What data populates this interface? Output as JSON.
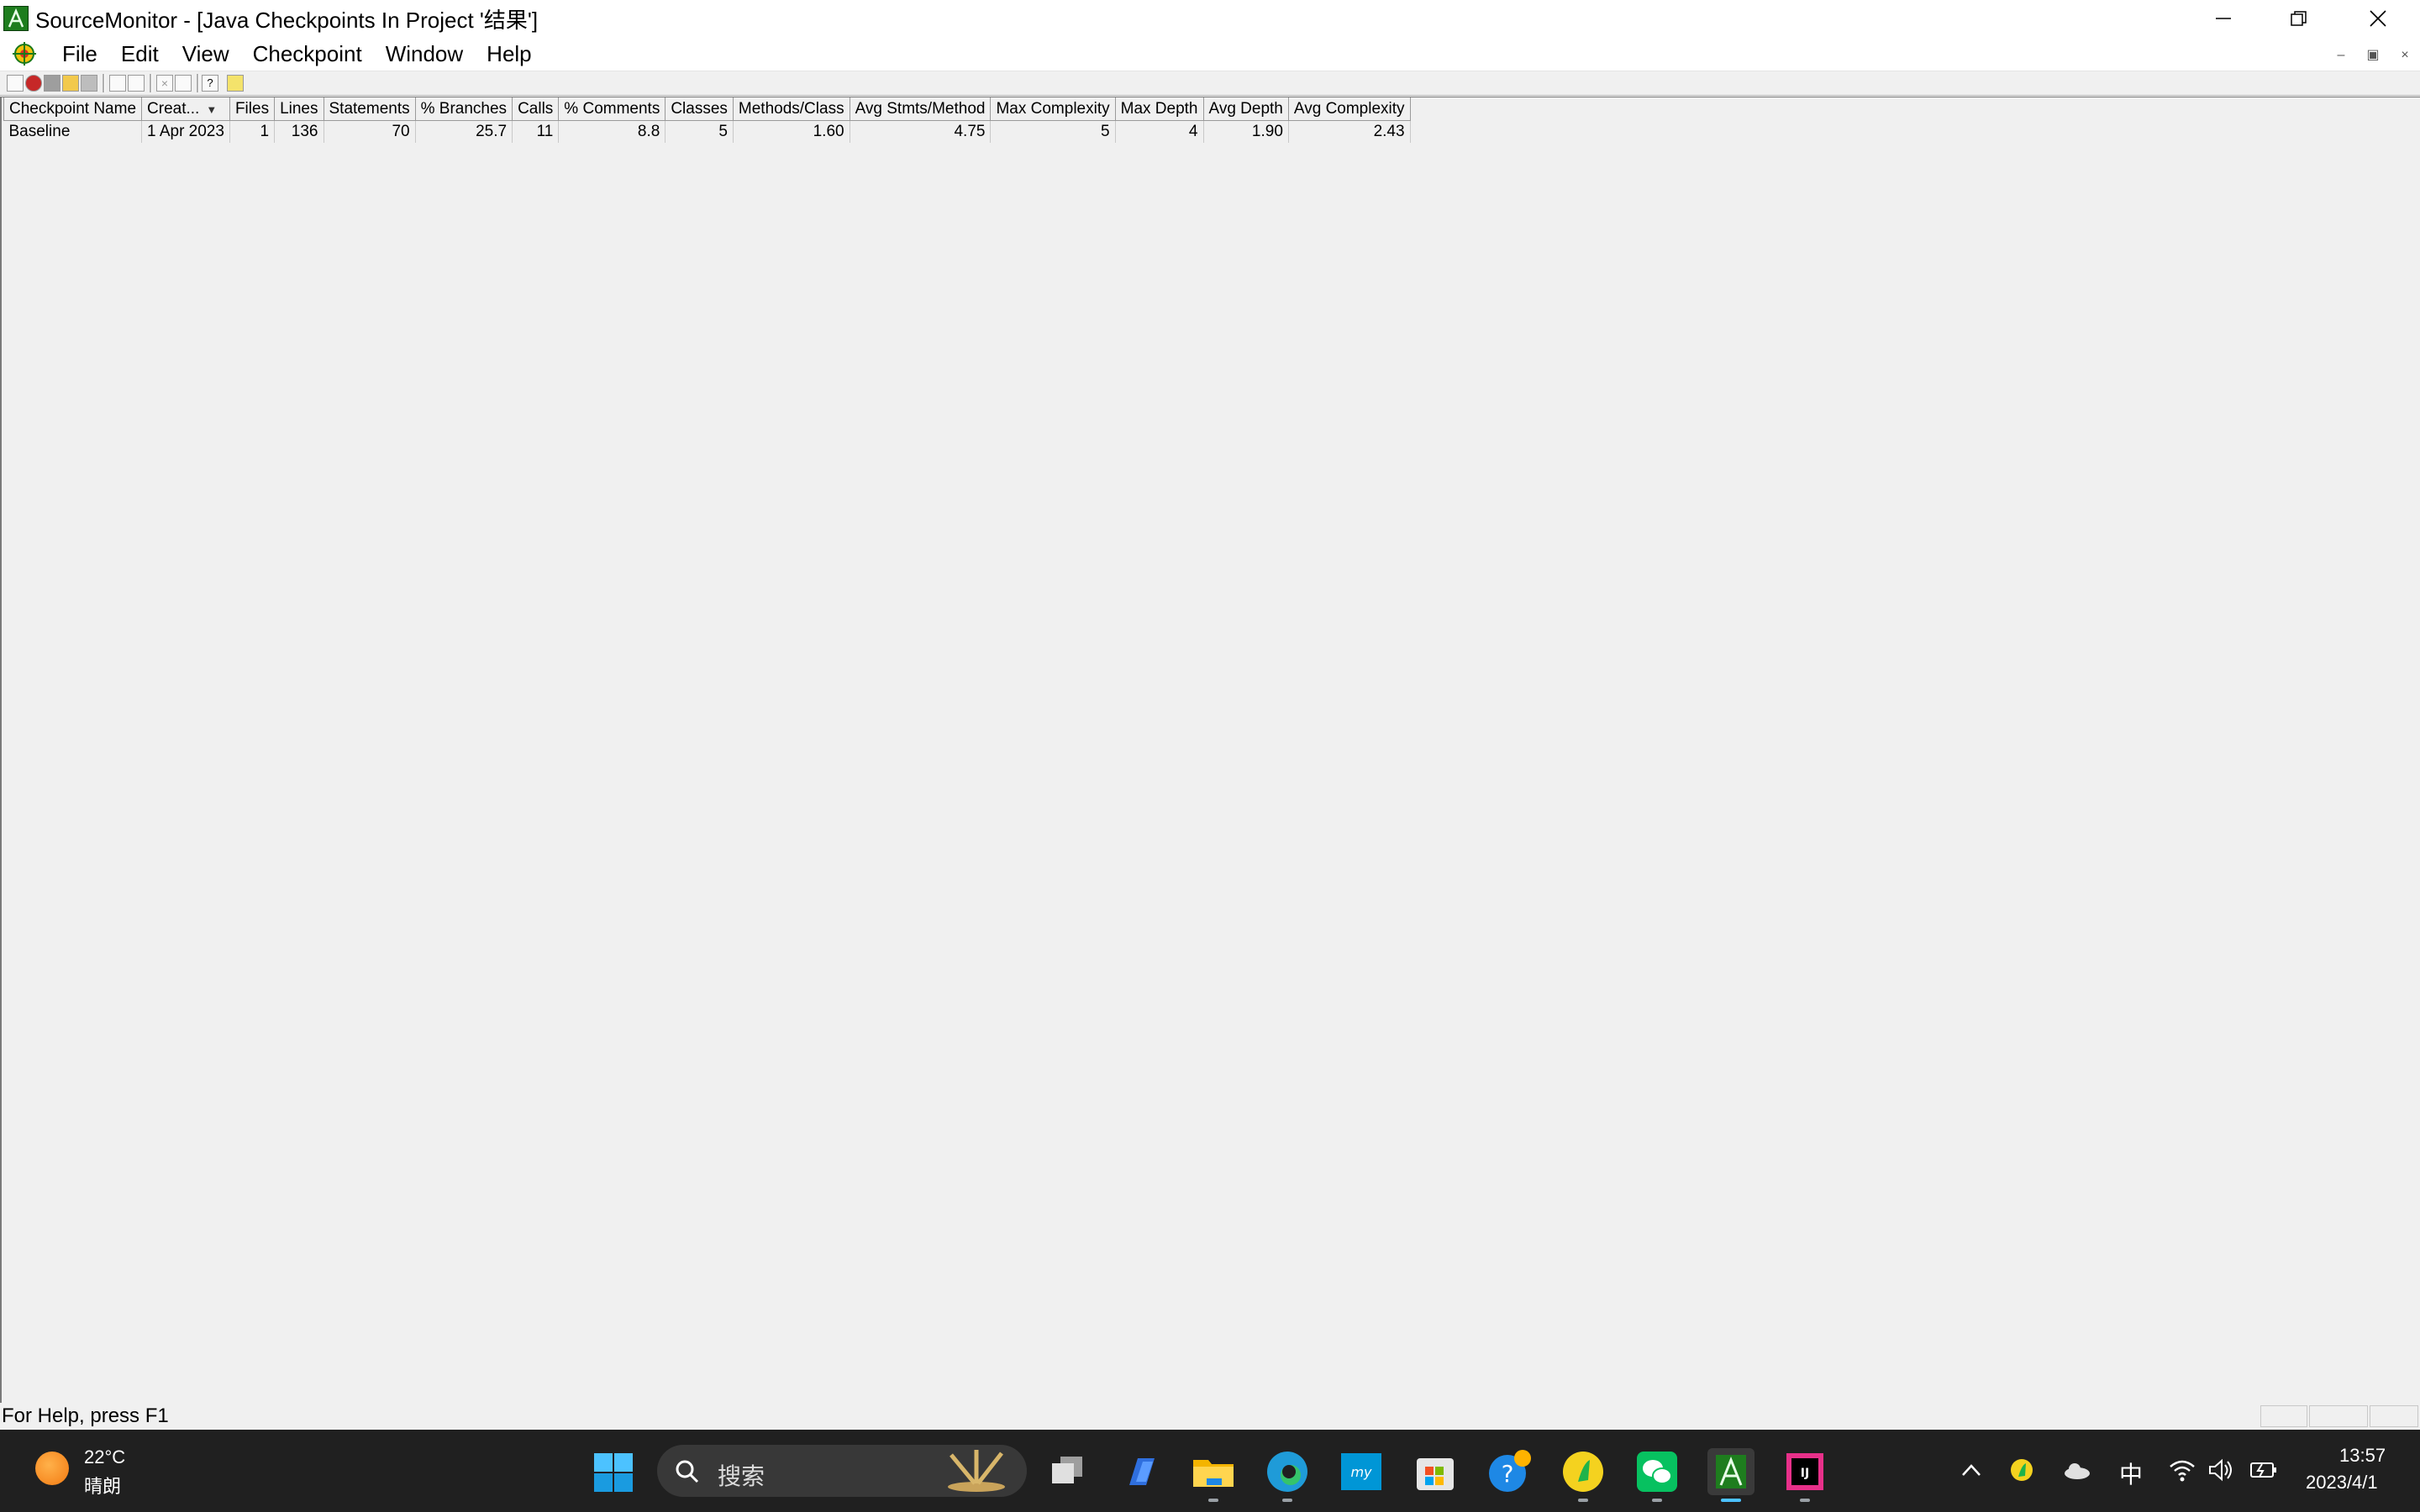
{
  "window": {
    "title": "SourceMonitor - [Java Checkpoints In Project '结果']",
    "controls": [
      "minimize",
      "restore",
      "close"
    ]
  },
  "menu": {
    "items": [
      "File",
      "Edit",
      "View",
      "Checkpoint",
      "Window",
      "Help"
    ]
  },
  "grid": {
    "columns": [
      "Checkpoint Name",
      "Creat...",
      "Files",
      "Lines",
      "Statements",
      "% Branches",
      "Calls",
      "% Comments",
      "Classes",
      "Methods/Class",
      "Avg Stmts/Method",
      "Max Complexity",
      "Max Depth",
      "Avg Depth",
      "Avg Complexity"
    ],
    "rows": [
      {
        "name": "Baseline",
        "created": "1 Apr 2023",
        "files": "1",
        "lines": "136",
        "statements": "70",
        "branches": "25.7",
        "calls": "11",
        "comments": "8.8",
        "classes": "5",
        "methods_per_class": "1.60",
        "avg_stmts_per_method": "4.75",
        "max_complexity": "5",
        "max_depth": "4",
        "avg_depth": "1.90",
        "avg_complexity": "2.43"
      }
    ]
  },
  "status": {
    "text": "For Help, press F1"
  },
  "taskbar": {
    "weather_temp": "22°C",
    "weather_desc": "晴朗",
    "search_placeholder": "搜索",
    "ime": "中",
    "time": "13:57",
    "date": "2023/4/1"
  }
}
